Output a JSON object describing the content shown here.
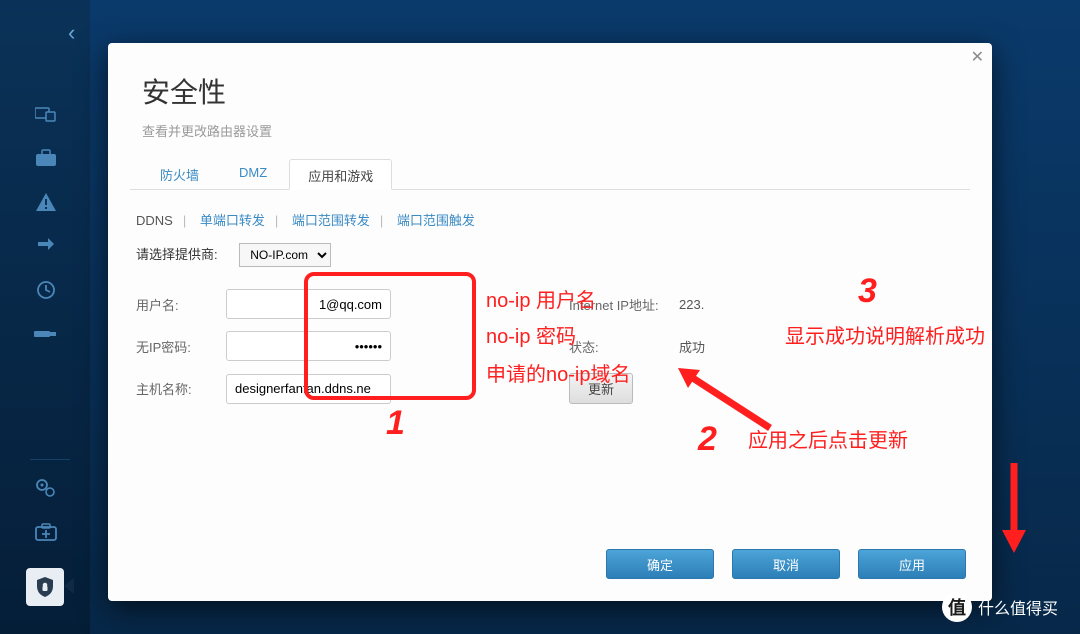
{
  "header": {
    "title": "安全性",
    "subtitle": "查看并更改路由器设置"
  },
  "tabs": {
    "t0": "防火墙",
    "t1": "DMZ",
    "t2": "应用和游戏"
  },
  "subtabs": {
    "s0": "DDNS",
    "s1": "单端口转发",
    "s2": "端口范围转发",
    "s3": "端口范围触发"
  },
  "provider": {
    "label": "请选择提供商:",
    "value": "NO-IP.com"
  },
  "form": {
    "user_label": "用户名:",
    "user_value": "1@qq.com",
    "pass_label": "无IP密码:",
    "pass_value": "••••••",
    "host_label": "主机名称:",
    "host_value": "designerfanfan.ddns.ne",
    "ip_label": "Internet IP地址:",
    "ip_value": "223.",
    "status_label": "状态:",
    "status_value": "成功",
    "update_btn": "更新"
  },
  "buttons": {
    "ok": "确定",
    "cancel": "取消",
    "apply": "应用"
  },
  "annotations": {
    "a1": "no-ip 用户名",
    "a2": "no-ip 密码",
    "a3": "申请的no-ip域名",
    "a4": "显示成功说明解析成功",
    "a5": "应用之后点击更新",
    "n1": "1",
    "n2": "2",
    "n3": "3"
  },
  "watermark": "什么值得买"
}
